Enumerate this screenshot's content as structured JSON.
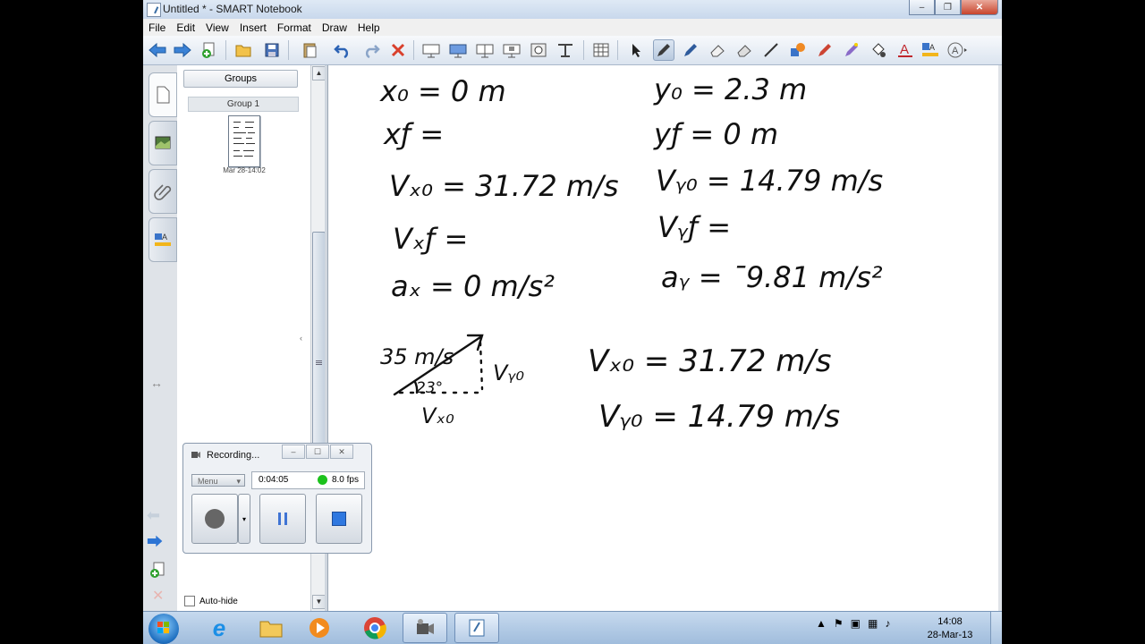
{
  "window": {
    "title": "Untitled * - SMART Notebook"
  },
  "menu": [
    "File",
    "Edit",
    "View",
    "Insert",
    "Format",
    "Draw",
    "Help"
  ],
  "toolbar_icons": [
    "back-arrow-icon",
    "forward-arrow-icon",
    "add-page-icon",
    "open-folder-icon",
    "save-icon",
    "paste-icon",
    "undo-icon",
    "redo-icon",
    "delete-icon",
    "screen-shade-icon",
    "full-screen-icon",
    "dual-page-icon",
    "capture-icon",
    "document-camera-icon",
    "table-icon",
    "select-pointer-icon",
    "pen-icon",
    "creative-pen-icon",
    "magic-pen-icon",
    "eraser-icon",
    "line-icon",
    "shapes-icon",
    "fill-icon",
    "text-pen-icon",
    "highlighter-icon",
    "properties-icon",
    "text-icon",
    "more-icon"
  ],
  "sidebar": {
    "groups_button": "Groups",
    "group_label": "Group 1",
    "thumbnail_date": "Mar 28-14:02",
    "autohide_label": "Auto-hide"
  },
  "canvas_notes": {
    "left": [
      "x₀ = 0 m",
      "xƒ =",
      "Vₓ₀ = 31.72 m/s",
      "Vₓƒ =",
      "aₓ = 0 m/s²"
    ],
    "right": [
      "y₀ = 2.3 m",
      "yƒ = 0 m",
      "Vᵧ₀ = 14.79 m/s",
      "Vᵧƒ =",
      "aᵧ = ˉ9.81 m/s²"
    ],
    "diagram": [
      "35 m/s",
      "23°",
      "Vᵧ₀",
      "Vₓ₀"
    ],
    "results": [
      "Vₓ₀ = 31.72 m/s",
      "Vᵧ₀ = 14.79 m/s"
    ]
  },
  "recorder": {
    "title": "Recording...",
    "menu_label": "Menu",
    "elapsed": "0:04:05",
    "fps": "8.0 fps",
    "status_color": "#1cc21c"
  },
  "taskbar": {
    "clock_time": "14:08",
    "clock_date": "28-Mar-13"
  }
}
